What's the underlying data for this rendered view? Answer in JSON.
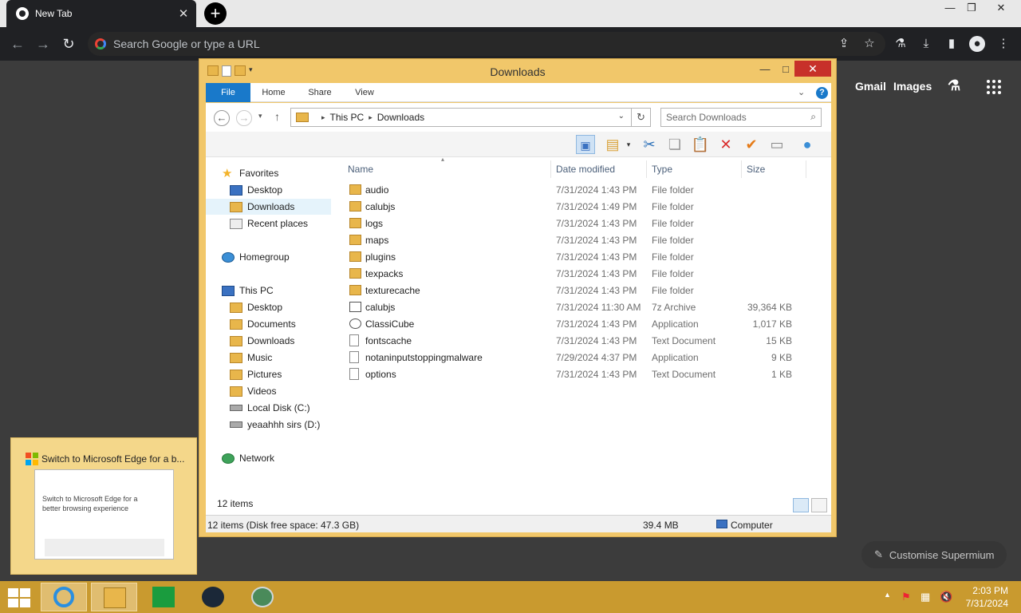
{
  "browser": {
    "tab_title": "New Tab",
    "omnibox_placeholder": "Search Google or type a URL"
  },
  "ntp": {
    "gmail": "Gmail",
    "images": "Images",
    "customise": "Customise Supermium"
  },
  "explorer": {
    "title": "Downloads",
    "ribbon_tabs": [
      "File",
      "Home",
      "Share",
      "View"
    ],
    "breadcrumb": [
      "This PC",
      "Downloads"
    ],
    "search_placeholder": "Search Downloads",
    "columns": {
      "name": "Name",
      "date": "Date modified",
      "type": "Type",
      "size": "Size"
    },
    "nav": {
      "favorites": "Favorites",
      "favorites_items": [
        "Desktop",
        "Downloads",
        "Recent places"
      ],
      "homegroup": "Homegroup",
      "this_pc": "This PC",
      "pc_items": [
        "Desktop",
        "Documents",
        "Downloads",
        "Music",
        "Pictures",
        "Videos",
        "Local Disk (C:)",
        "yeaahhh sirs (D:)"
      ],
      "network": "Network"
    },
    "files": [
      {
        "name": "audio",
        "date": "7/31/2024 1:43 PM",
        "type": "File folder",
        "size": "",
        "icon": "folder-icon"
      },
      {
        "name": "calubjs",
        "date": "7/31/2024 1:49 PM",
        "type": "File folder",
        "size": "",
        "icon": "folder-icon"
      },
      {
        "name": "logs",
        "date": "7/31/2024 1:43 PM",
        "type": "File folder",
        "size": "",
        "icon": "folder-icon"
      },
      {
        "name": "maps",
        "date": "7/31/2024 1:43 PM",
        "type": "File folder",
        "size": "",
        "icon": "folder-icon"
      },
      {
        "name": "plugins",
        "date": "7/31/2024 1:43 PM",
        "type": "File folder",
        "size": "",
        "icon": "folder-icon"
      },
      {
        "name": "texpacks",
        "date": "7/31/2024 1:43 PM",
        "type": "File folder",
        "size": "",
        "icon": "folder-icon"
      },
      {
        "name": "texturecache",
        "date": "7/31/2024 1:43 PM",
        "type": "File folder",
        "size": "",
        "icon": "folder-icon"
      },
      {
        "name": "calubjs",
        "date": "7/31/2024 11:30 AM",
        "type": "7z Archive",
        "size": "39,364 KB",
        "icon": "archive-icon"
      },
      {
        "name": "ClassiCube",
        "date": "7/31/2024 1:43 PM",
        "type": "Application",
        "size": "1,017 KB",
        "icon": "app-icon"
      },
      {
        "name": "fontscache",
        "date": "7/31/2024 1:43 PM",
        "type": "Text Document",
        "size": "15 KB",
        "icon": "text-file-icon"
      },
      {
        "name": "notaninputstoppingmalware",
        "date": "7/29/2024 4:37 PM",
        "type": "Application",
        "size": "9 KB",
        "icon": "text-file-icon"
      },
      {
        "name": "options",
        "date": "7/31/2024 1:43 PM",
        "type": "Text Document",
        "size": "1 KB",
        "icon": "text-file-icon"
      }
    ],
    "item_count": "12 items",
    "status_detail": "12 items (Disk free space: 47.3 GB)",
    "status_size": "39.4 MB",
    "status_location": "Computer"
  },
  "preview": {
    "title": "Switch to Microsoft Edge for a b...",
    "thumb_text": "Switch to Microsoft Edge for a better browsing experience"
  },
  "taskbar": {
    "time": "2:03 PM",
    "date": "7/31/2024"
  },
  "colors": {
    "explorer_frame": "#f1c76a",
    "taskbar": "#c99a2f",
    "file_tab": "#1979ca",
    "close_button": "#c7302a"
  }
}
